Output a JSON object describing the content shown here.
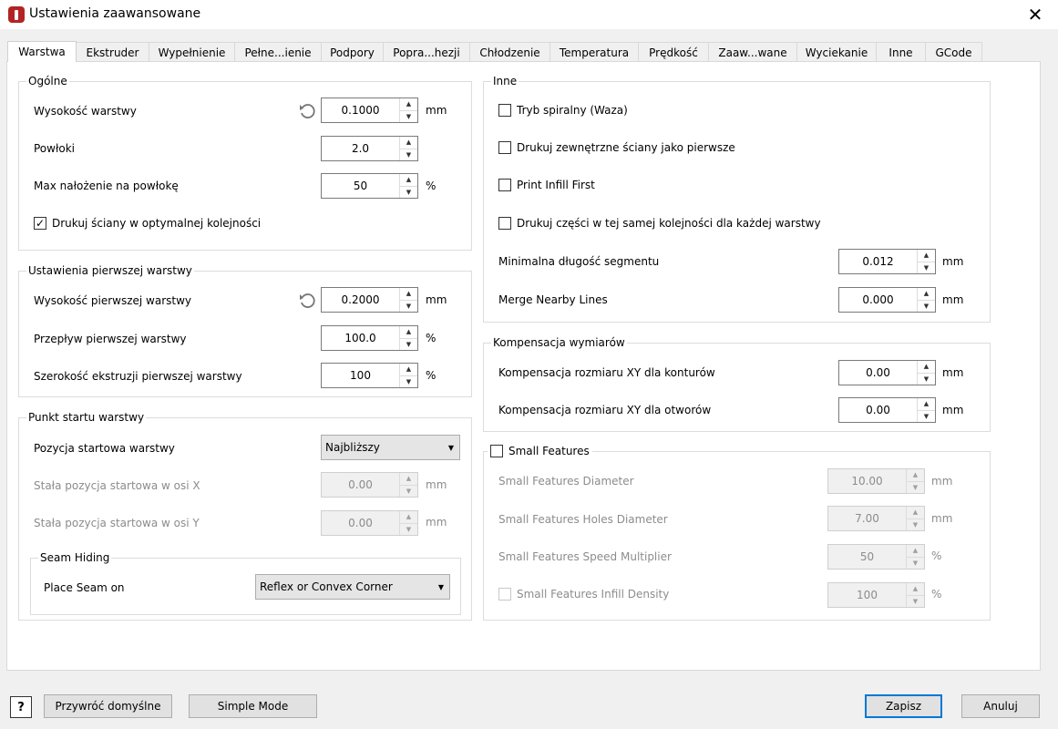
{
  "window": {
    "title": "Ustawienia zaawansowane"
  },
  "tabs": [
    {
      "label": "Warstwa"
    },
    {
      "label": "Ekstruder"
    },
    {
      "label": "Wypełnienie"
    },
    {
      "label": "Pełne...ienie"
    },
    {
      "label": "Podpory"
    },
    {
      "label": "Popra...hezji"
    },
    {
      "label": "Chłodzenie"
    },
    {
      "label": "Temperatura"
    },
    {
      "label": "Prędkość"
    },
    {
      "label": "Zaaw...wane"
    },
    {
      "label": "Wyciekanie"
    },
    {
      "label": "Inne"
    },
    {
      "label": "GCode"
    }
  ],
  "general": {
    "title": "Ogólne",
    "layer_height": {
      "label": "Wysokość warstwy",
      "value": "0.1000",
      "unit": "mm"
    },
    "shells": {
      "label": "Powłoki",
      "value": "2.0"
    },
    "max_overlap": {
      "label": "Max nałożenie na powłokę",
      "value": "50",
      "unit": "%"
    },
    "optimal_order": {
      "label": "Drukuj ściany w optymalnej kolejności",
      "check": "✓"
    }
  },
  "first_layer": {
    "title": "Ustawienia pierwszej warstwy",
    "height": {
      "label": "Wysokość pierwszej warstwy",
      "value": "0.2000",
      "unit": "mm"
    },
    "flow": {
      "label": "Przepływ pierwszej warstwy",
      "value": "100.0",
      "unit": "%"
    },
    "width": {
      "label": "Szerokość ekstruzji pierwszej warstwy",
      "value": "100",
      "unit": "%"
    }
  },
  "start_point": {
    "title": "Punkt startu warstwy",
    "position": {
      "label": "Pozycja startowa warstwy",
      "value": "Najbliższy"
    },
    "fixed_x": {
      "label": "Stała pozycja startowa w osi X",
      "value": "0.00",
      "unit": "mm"
    },
    "fixed_y": {
      "label": "Stała pozycja startowa w osi Y",
      "value": "0.00",
      "unit": "mm"
    },
    "seam": {
      "title": "Seam Hiding",
      "label": "Place Seam on",
      "value": "Reflex or Convex Corner"
    }
  },
  "other": {
    "title": "Inne",
    "spiral": {
      "label": "Tryb spiralny (Waza)"
    },
    "outer_first": {
      "label": "Drukuj zewnętrzne ściany jako pierwsze"
    },
    "infill_first": {
      "label": "Print Infill First"
    },
    "same_order": {
      "label": "Drukuj części w tej samej kolejności dla każdej warstwy"
    },
    "min_segment": {
      "label": "Minimalna długość segmentu",
      "value": "0.012",
      "unit": "mm"
    },
    "merge_lines": {
      "label": "Merge Nearby Lines",
      "value": "0.000",
      "unit": "mm"
    }
  },
  "compensation": {
    "title": "Kompensacja wymiarów",
    "contours": {
      "label": "Kompensacja rozmiaru XY dla konturów",
      "value": "0.00",
      "unit": "mm"
    },
    "holes": {
      "label": "Kompensacja rozmiaru XY dla otworów",
      "value": "0.00",
      "unit": "mm"
    }
  },
  "small": {
    "title": "Small Features",
    "diameter": {
      "label": "Small Features Diameter",
      "value": "10.00",
      "unit": "mm"
    },
    "holes_diameter": {
      "label": "Small Features Holes Diameter",
      "value": "7.00",
      "unit": "mm"
    },
    "speed": {
      "label": "Small Features Speed Multiplier",
      "value": "50",
      "unit": "%"
    },
    "infill": {
      "label": "Small Features Infill Density",
      "value": "100",
      "unit": "%"
    }
  },
  "footer": {
    "help": "?",
    "restore": "Przywróć domyślne",
    "simple": "Simple Mode",
    "save": "Zapisz",
    "cancel": "Anuluj"
  }
}
